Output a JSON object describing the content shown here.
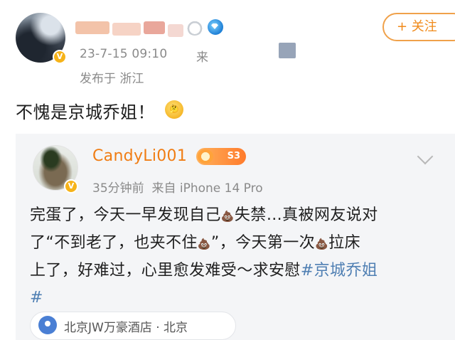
{
  "outer_post": {
    "date": "23-7-15 09:10",
    "source_prefix": "来",
    "location_line": "发布于 浙江",
    "follow_label": "+ 关注",
    "text": "不愧是京城乔姐！",
    "verified_mark": "V",
    "colors": {
      "name_blur_1": "#f3c3a9",
      "name_blur_2": "#e9a79b",
      "follow": "#f08a1a"
    }
  },
  "repost": {
    "username": "CandyLi001",
    "level_badge": "S3",
    "time": "35分钟前",
    "source": "来自 iPhone 14 Pro",
    "text_segments": {
      "l1a": "完蛋了，今天一早发现自己",
      "l1b": "失禁…真被网友说对",
      "l2a": "了“不到老了，也夹不住",
      "l2b": "”，今天第一次",
      "l2c": "拉床",
      "l3a": "上了，好难过，心里愈发难受～求安慰",
      "hashtag": "#京城乔姐",
      "l4": "#"
    },
    "location": "北京JW万豪酒店 · 北京",
    "verified_mark": "V",
    "colors": {
      "username": "#f07d14",
      "hashtag": "#4f7fb3"
    }
  },
  "icons": [
    "avatar",
    "verified-badge",
    "bear-icon",
    "diamond-icon",
    "thinking-emoji",
    "poop-emoji",
    "chevron-down-icon",
    "location-icon",
    "level-badge"
  ]
}
